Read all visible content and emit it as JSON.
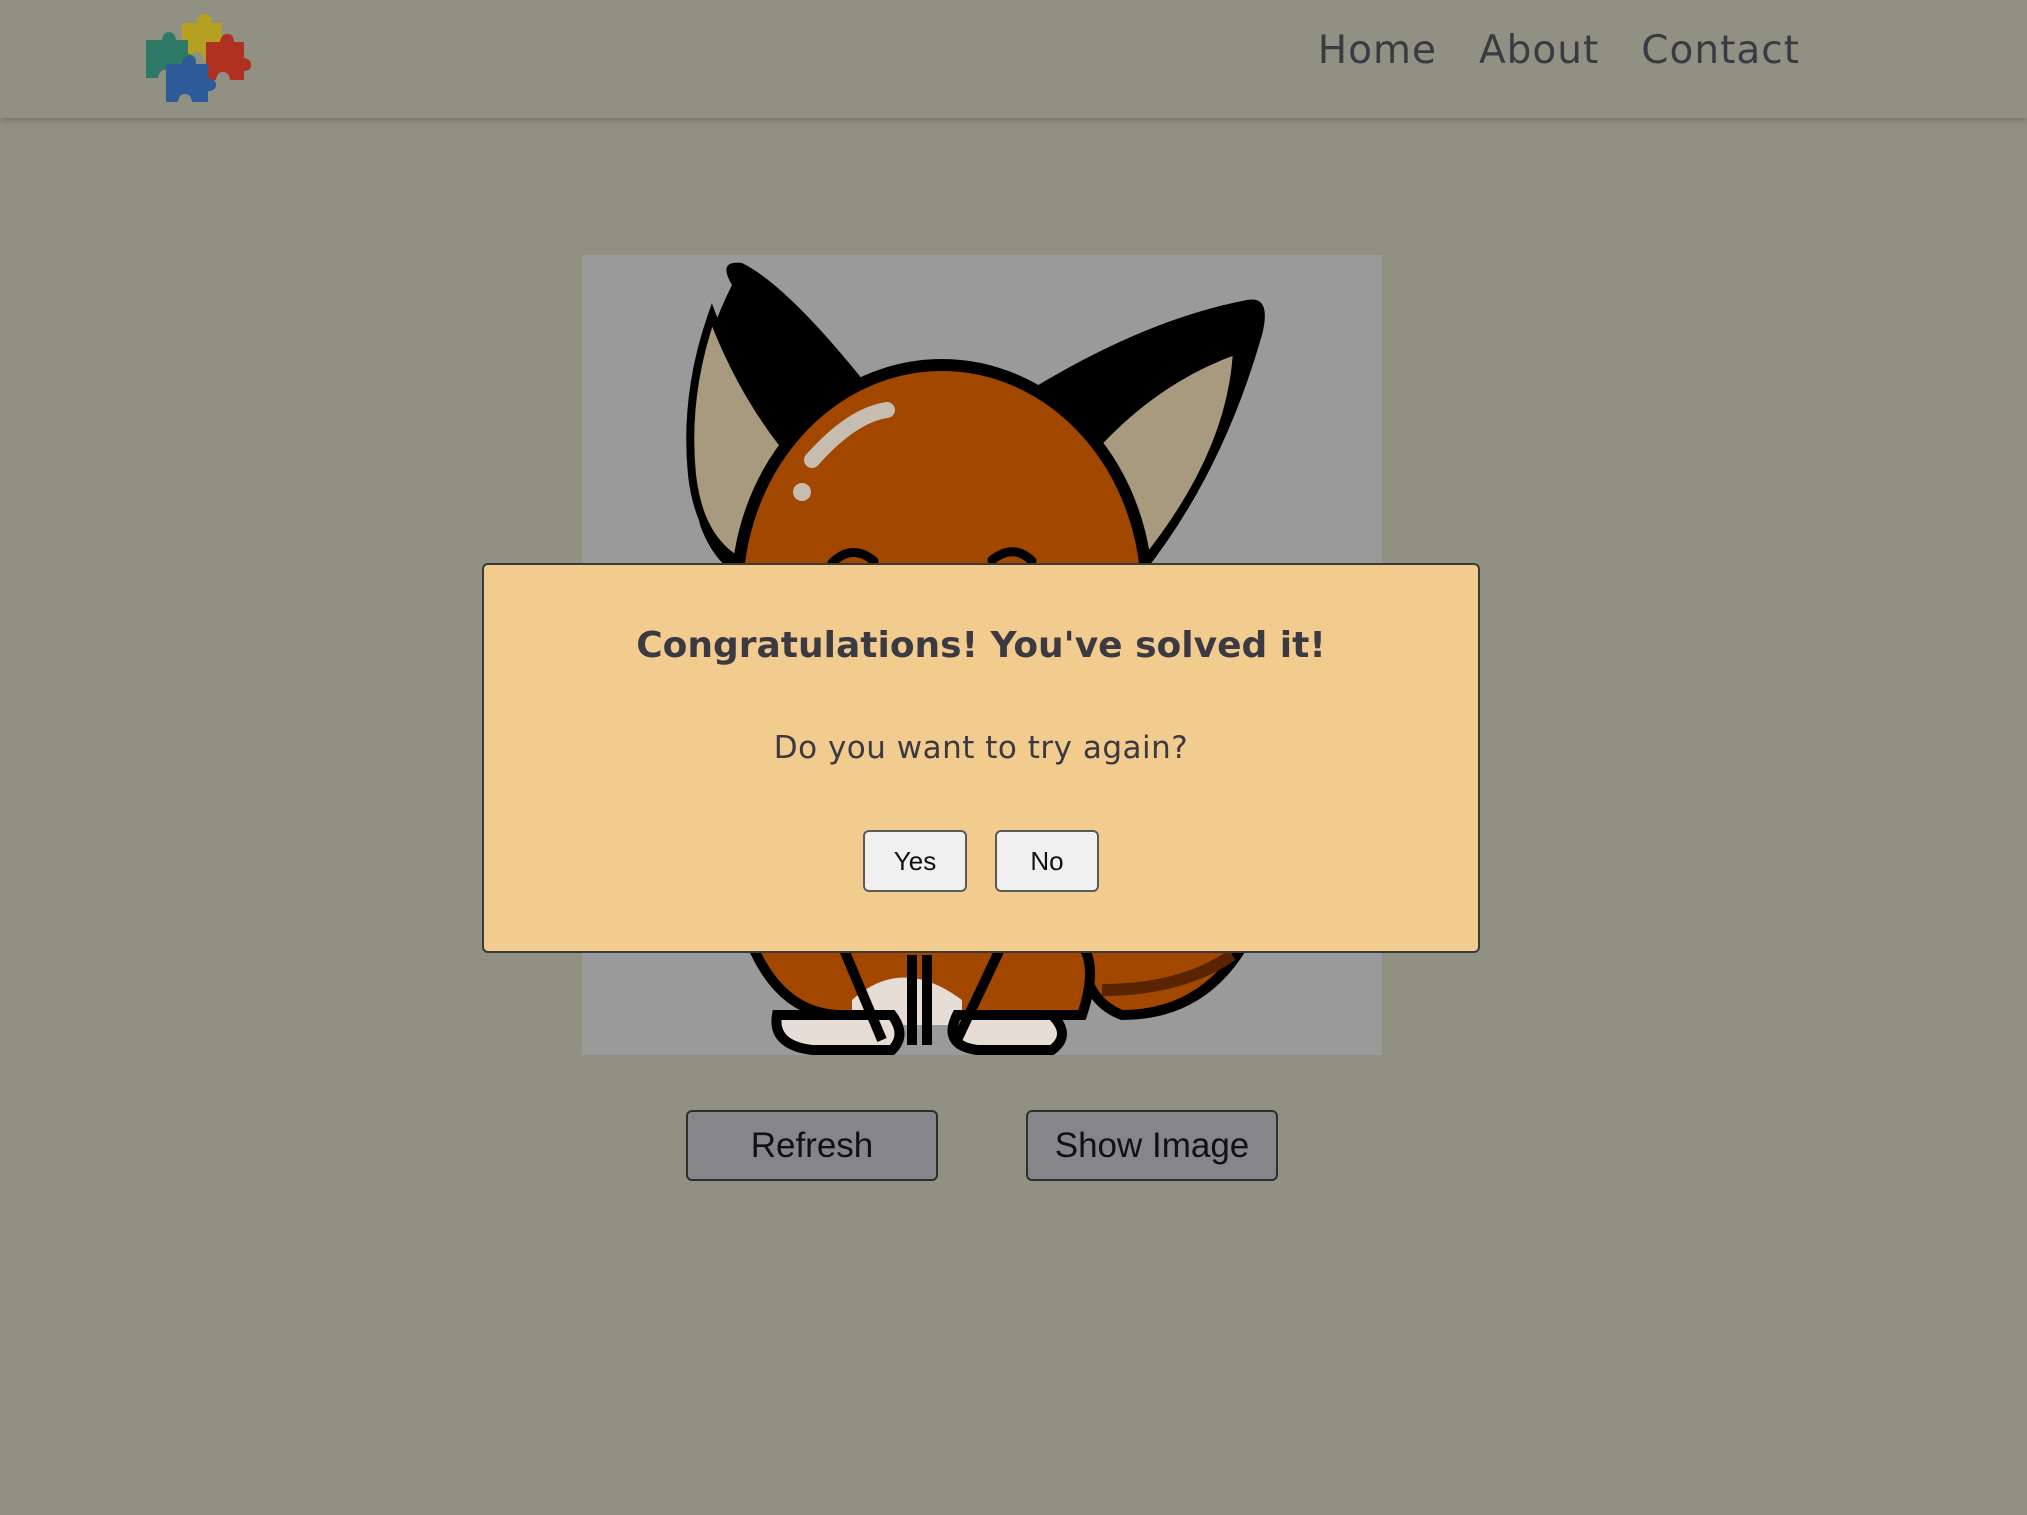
{
  "header": {
    "logo_icon": "puzzle-pieces-logo",
    "nav": [
      {
        "label": "Home"
      },
      {
        "label": "About"
      },
      {
        "label": "Contact"
      }
    ]
  },
  "puzzle": {
    "image_subject": "fox-cartoon",
    "background_color": "#9a9a9a"
  },
  "controls": {
    "refresh_label": "Refresh",
    "show_image_label": "Show Image"
  },
  "modal": {
    "title": "Congratulations! You've solved it!",
    "question": "Do you want to try again?",
    "yes_label": "Yes",
    "no_label": "No"
  },
  "colors": {
    "overlay_background": "#919183",
    "modal_background": "#f2cb8e",
    "text": "#3b3a43"
  }
}
